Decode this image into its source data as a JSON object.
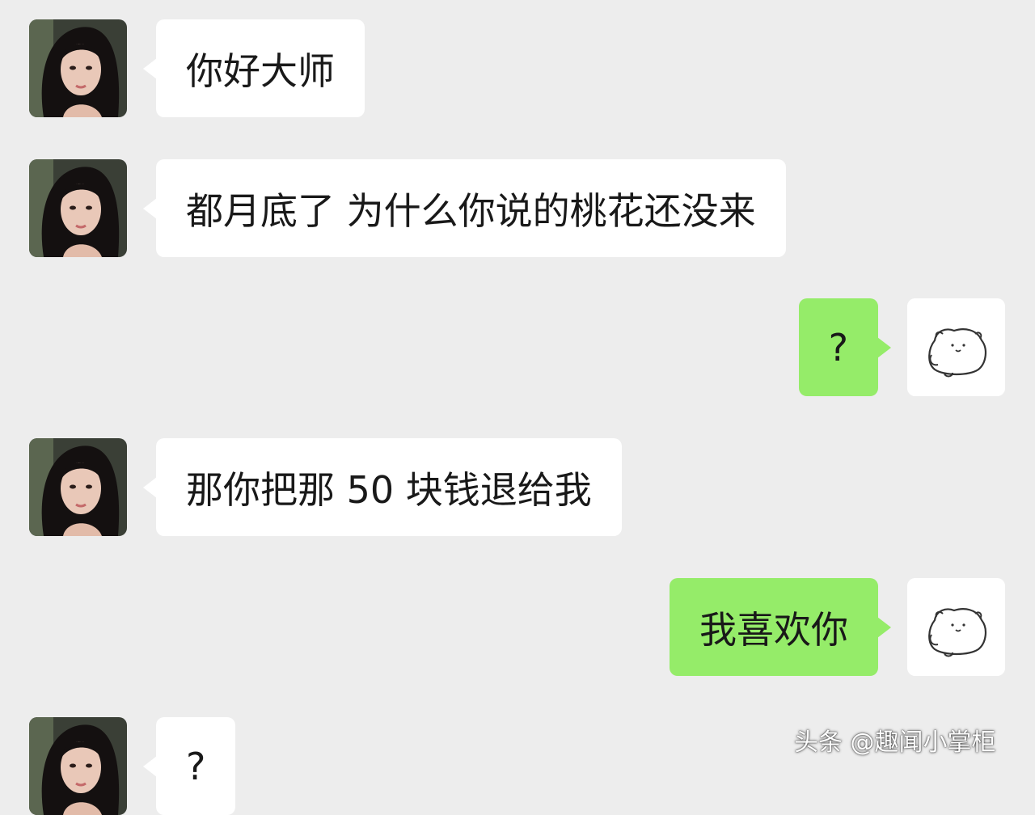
{
  "conversation": {
    "messages": [
      {
        "side": "left",
        "text": "你好大师",
        "avatar": "girl-portrait"
      },
      {
        "side": "left",
        "text": "都月底了 为什么你说的桃花还没来",
        "avatar": "girl-portrait"
      },
      {
        "side": "right",
        "text": "?",
        "avatar": "cartoon-bear-sketch"
      },
      {
        "side": "left",
        "text": "那你把那 50 块钱退给我",
        "avatar": "girl-portrait"
      },
      {
        "side": "right",
        "text": "我喜欢你",
        "avatar": "cartoon-bear-sketch"
      },
      {
        "side": "left",
        "text": "?",
        "avatar": "girl-portrait"
      }
    ]
  },
  "watermark": {
    "text": "头条 @趣闻小掌柜"
  },
  "colors": {
    "background": "#ededed",
    "incoming_bubble": "#ffffff",
    "outgoing_bubble": "#95ec69",
    "text": "#191919"
  }
}
